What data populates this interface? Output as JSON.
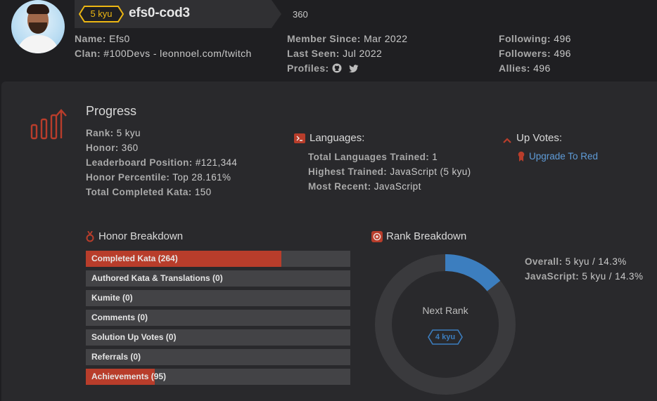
{
  "header": {
    "rank": "5 kyu",
    "username": "efs0-cod3",
    "honor": "360",
    "left": {
      "name_label": "Name:",
      "name_value": "Efs0",
      "clan_label": "Clan:",
      "clan_value": "#100Devs - leonnoel.com/twitch"
    },
    "middle": {
      "member_label": "Member Since:",
      "member_value": "Mar 2022",
      "seen_label": "Last Seen:",
      "seen_value": "Jul 2022",
      "profiles_label": "Profiles:"
    },
    "right": {
      "following_label": "Following:",
      "following_value": "496",
      "followers_label": "Followers:",
      "followers_value": "496",
      "allies_label": "Allies:",
      "allies_value": "496"
    }
  },
  "progress": {
    "title": "Progress",
    "rank_label": "Rank:",
    "rank_value": "5 kyu",
    "honor_label": "Honor:",
    "honor_value": "360",
    "leader_label": "Leaderboard Position:",
    "leader_value": "#121,344",
    "percentile_label": "Honor Percentile:",
    "percentile_value": "Top 28.161%",
    "kata_label": "Total Completed Kata:",
    "kata_value": "150"
  },
  "languages": {
    "title": "Languages:",
    "trained_label": "Total Languages Trained:",
    "trained_value": "1",
    "highest_label": "Highest Trained:",
    "highest_value": "JavaScript (5 kyu)",
    "recent_label": "Most Recent:",
    "recent_value": "JavaScript"
  },
  "upvotes": {
    "title": "Up Votes:",
    "link": "Upgrade To Red"
  },
  "honor_breakdown": {
    "title": "Honor Breakdown",
    "bars": [
      {
        "label": "Completed Kata (264)",
        "fill": 0.74
      },
      {
        "label": "Authored Kata & Translations (0)",
        "fill": 0
      },
      {
        "label": "Kumite (0)",
        "fill": 0
      },
      {
        "label": "Comments (0)",
        "fill": 0
      },
      {
        "label": "Solution Up Votes (0)",
        "fill": 0
      },
      {
        "label": "Referrals (0)",
        "fill": 0
      },
      {
        "label": "Achievements (95)",
        "fill": 0.26
      }
    ]
  },
  "rank_breakdown": {
    "title": "Rank Breakdown",
    "progress_fraction": 0.143,
    "next_rank_label": "Next Rank",
    "next_rank": "4 kyu",
    "overall_label": "Overall:",
    "overall_value": "5 kyu / 14.3%",
    "js_label": "JavaScript:",
    "js_value": "5 kyu / 14.3%"
  },
  "colors": {
    "accent": "#b83d2b",
    "rank_yellow": "#ecb613",
    "ring_blue": "#3c7ebf",
    "ring_gray": "#3a3a3d"
  },
  "icons": [
    "github-icon",
    "twitter-icon",
    "chart-icon",
    "terminal-icon",
    "chevron-up-icon",
    "ribbon-icon",
    "medal-icon",
    "target-icon"
  ]
}
